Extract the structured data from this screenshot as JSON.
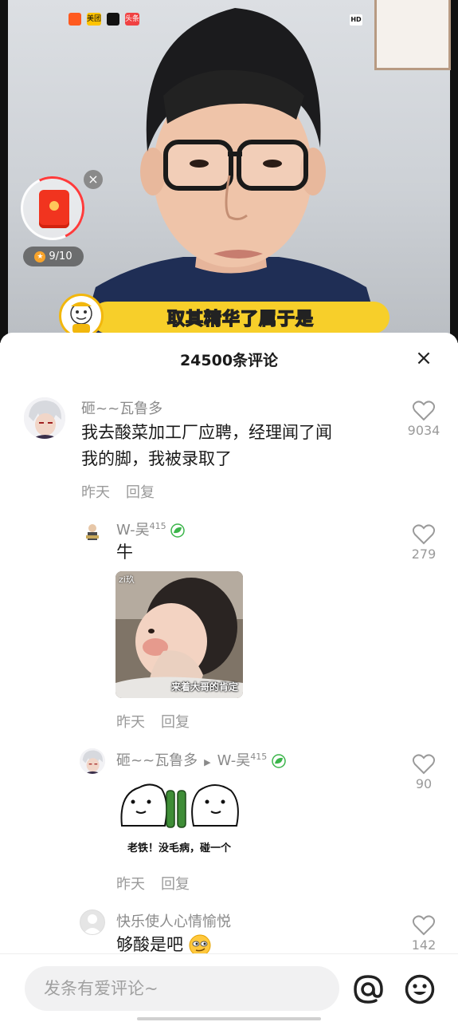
{
  "video": {
    "badges": [
      {
        "name": "kuaishou-icon",
        "color": "#ff5a1f",
        "text": ""
      },
      {
        "name": "meituan-icon",
        "color": "#ffc300",
        "text": "美团"
      },
      {
        "name": "capcut-icon",
        "color": "#111111",
        "text": ""
      },
      {
        "name": "toutiao-icon",
        "color": "#f04142",
        "text": "头条"
      }
    ],
    "hd_label": "HD",
    "subtitle": "取其精华了属于是",
    "redpacket_progress": "9/10",
    "redpacket_close": "×"
  },
  "sheet": {
    "title": "24500条评论",
    "close": "×"
  },
  "comments": [
    {
      "user": "砸~~瓦鲁多",
      "text_line1": "我去酸菜加工厂应聘，经理闻了闻",
      "text_line2": "我的脚，我被录取了",
      "time": "昨天",
      "reply": "回复",
      "likes": "9034"
    },
    {
      "user": "W-吴",
      "level": "415",
      "text": "牛",
      "sticker_tag": "zi玖",
      "sticker_caption": "来着大哥的肯定",
      "time": "昨天",
      "reply": "回复",
      "likes": "279"
    },
    {
      "user": "砸~~瓦鲁多",
      "reply_to": "W-吴",
      "level": "415",
      "sticker_caption": "老铁！没毛病，碰一个",
      "time": "昨天",
      "reply": "回复",
      "likes": "90"
    },
    {
      "user": "快乐使人心情愉悦",
      "text": "够酸是吧",
      "likes": "142"
    }
  ],
  "input": {
    "placeholder": "发条有爱评论~"
  },
  "colors": {
    "accent_yellow": "#f7cf2a",
    "red": "#f1341f",
    "muted_text": "#8a8a8a"
  }
}
